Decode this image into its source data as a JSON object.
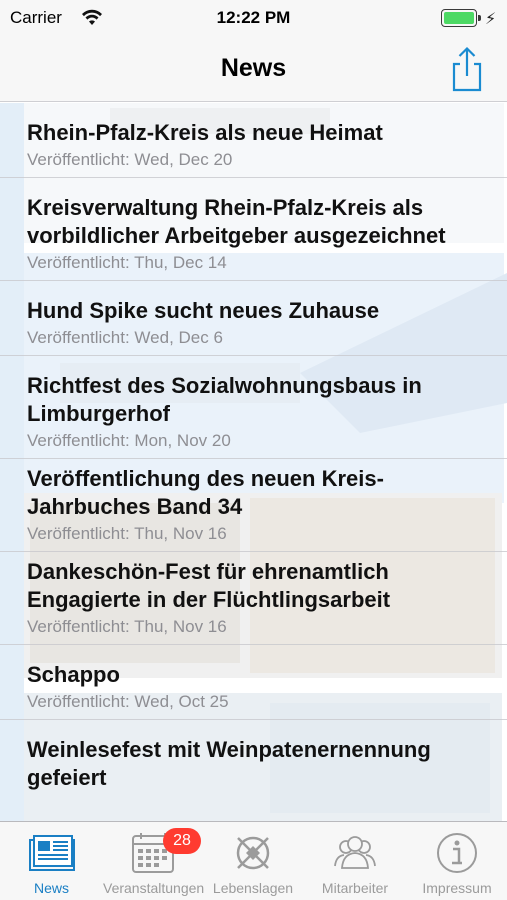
{
  "status_bar": {
    "carrier": "Carrier",
    "time": "12:22 PM"
  },
  "nav": {
    "title": "News"
  },
  "news": [
    {
      "title": "Rhein-Pfalz-Kreis als neue Heimat",
      "date": "Veröffentlicht: Wed, Dec 20"
    },
    {
      "title": "Kreisverwaltung Rhein-Pfalz-Kreis als vorbildlicher Arbeitgeber ausgezeichnet",
      "date": "Veröffentlicht: Thu, Dec 14"
    },
    {
      "title": "Hund Spike sucht neues Zuhause",
      "date": "Veröffentlicht: Wed, Dec 6"
    },
    {
      "title": "Richtfest des Sozialwohnungsbaus in Limburgerhof",
      "date": "Veröffentlicht: Mon, Nov 20"
    },
    {
      "title": "Veröffentlichung des neuen Kreis-Jahrbuches Band 34",
      "date": "Veröffentlicht: Thu, Nov 16"
    },
    {
      "title": "Dankeschön-Fest für ehrenamtlich Engagierte in der Flüchtlingsarbeit",
      "date": "Veröffentlicht: Thu, Nov 16"
    },
    {
      "title": "Schappo",
      "date": "Veröffentlicht: Wed, Oct 25"
    },
    {
      "title": "Weinlesefest mit Weinpatenernennung gefeiert",
      "date": ""
    }
  ],
  "tabs": [
    {
      "label": "News",
      "icon": "newspaper-icon",
      "active": true
    },
    {
      "label": "Veranstaltungen",
      "icon": "calendar-icon",
      "badge": "28"
    },
    {
      "label": "Lebenslagen",
      "icon": "compass-icon"
    },
    {
      "label": "Mitarbeiter",
      "icon": "people-icon"
    },
    {
      "label": "Impressum",
      "icon": "info-icon"
    }
  ],
  "colors": {
    "accent": "#1a7fc4",
    "badge": "#ff3b30",
    "battery": "#4cd964",
    "inactive": "#9b9b9b"
  }
}
